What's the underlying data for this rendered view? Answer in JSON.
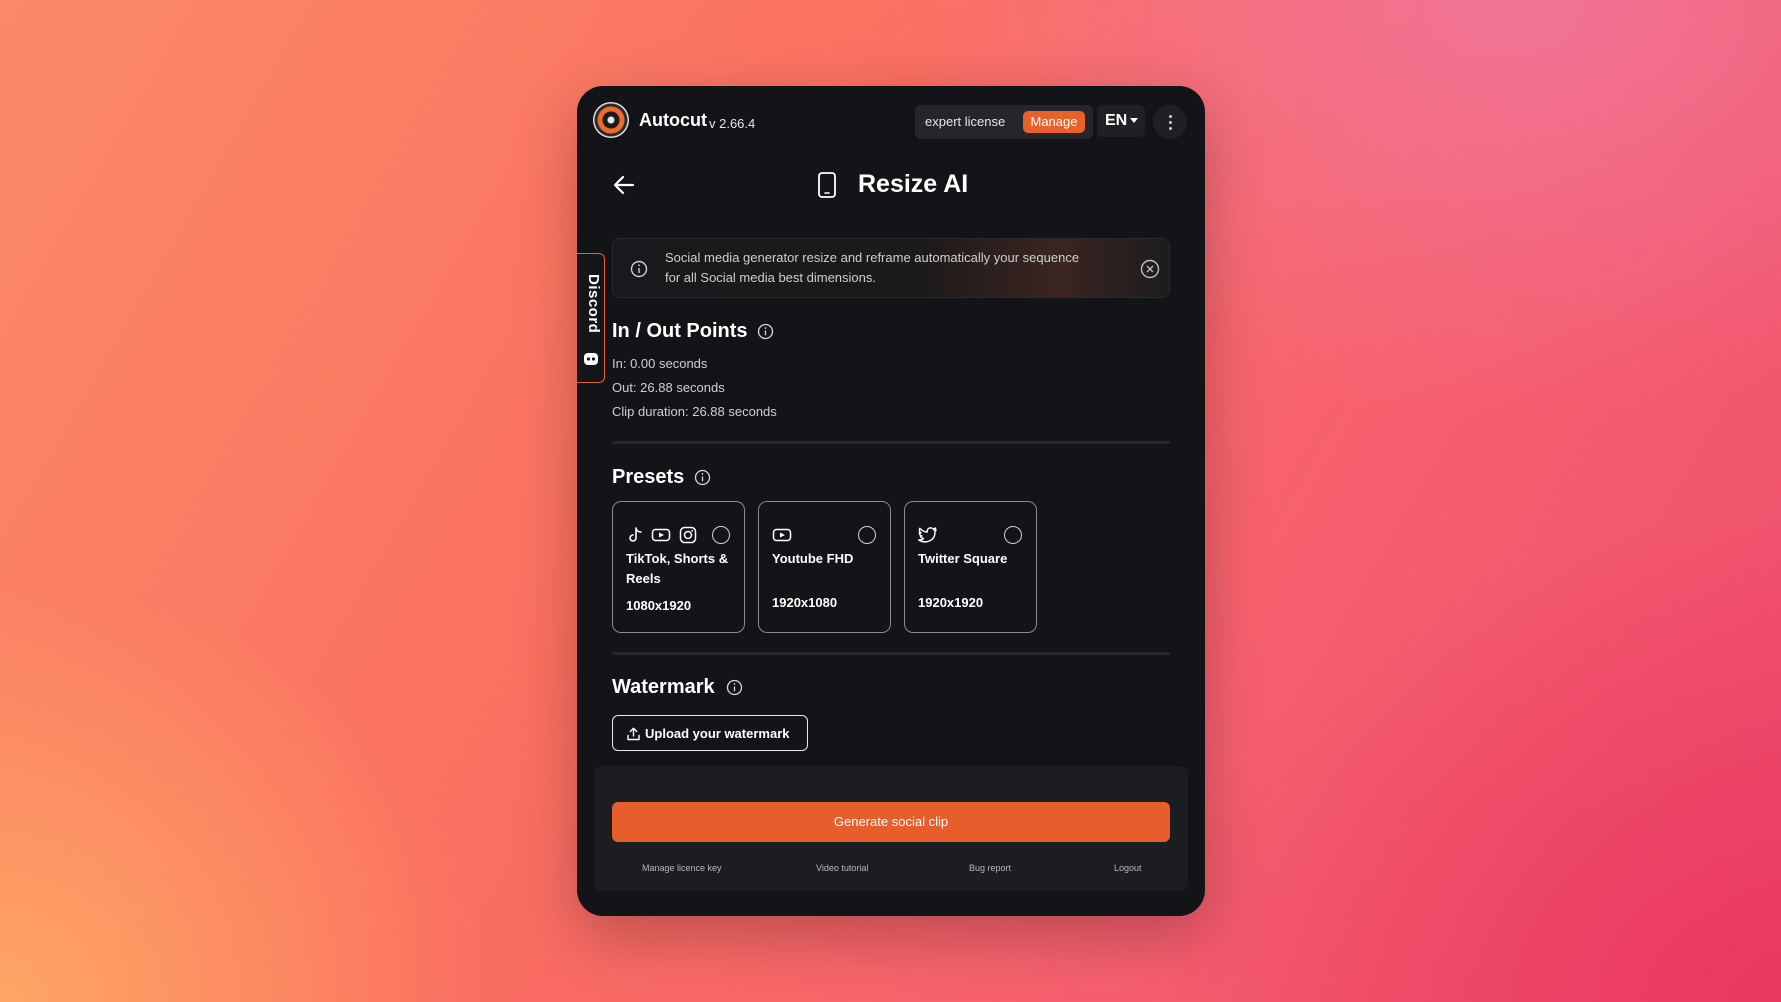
{
  "header": {
    "brand": "Autocut",
    "version": "v 2.66.4",
    "license": "expert license",
    "manage_label": "Manage",
    "language": "EN"
  },
  "page": {
    "title": "Resize AI"
  },
  "sidebar_tab": {
    "label": "Discord"
  },
  "banner": {
    "text": "Social media generator resize and reframe automatically your sequence for all Social media best dimensions."
  },
  "in_out": {
    "title": "In / Out Points",
    "in": "In: 0.00 seconds",
    "out": "Out: 26.88 seconds",
    "duration": "Clip duration: 26.88 seconds"
  },
  "presets": {
    "title": "Presets",
    "items": [
      {
        "name": "TikTok, Shorts & Reels",
        "size": "1080x1920",
        "icons": [
          "tiktok-icon",
          "youtube-icon",
          "instagram-icon"
        ],
        "selected": false
      },
      {
        "name": "Youtube FHD",
        "size": "1920x1080",
        "icons": [
          "youtube-icon"
        ],
        "selected": false
      },
      {
        "name": "Twitter Square",
        "size": "1920x1920",
        "icons": [
          "twitter-icon"
        ],
        "selected": false
      }
    ]
  },
  "watermark": {
    "title": "Watermark",
    "upload_label": "Upload your watermark"
  },
  "footer": {
    "generate_label": "Generate social clip",
    "links": [
      "Manage licence key",
      "Video tutorial",
      "Bug report",
      "Logout"
    ]
  },
  "colors": {
    "accent": "#e8602a",
    "panel_bg": "#131417",
    "footer_bg": "#1c1d21"
  }
}
